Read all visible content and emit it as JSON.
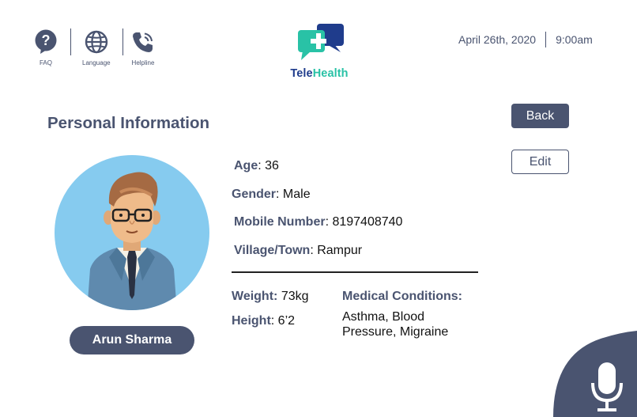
{
  "header": {
    "icons": [
      {
        "name": "faq-icon",
        "label": "FAQ"
      },
      {
        "name": "globe-icon",
        "label": "Language"
      },
      {
        "name": "phone-icon",
        "label": "Helpline"
      }
    ],
    "logo": {
      "part1": "Tele",
      "part2": "Health"
    },
    "date": "April 26th, 2020",
    "time": "9:00am"
  },
  "page": {
    "title": "Personal Information"
  },
  "actions": {
    "back_label": "Back",
    "edit_label": "Edit"
  },
  "profile": {
    "name": "Arun Sharma",
    "age_label": "Age",
    "age": "36",
    "gender_label": "Gender",
    "gender": "Male",
    "mobile_label": "Mobile Number",
    "mobile": "8197408740",
    "village_label": "Village/Town",
    "village": "Rampur",
    "weight_label": "Weight:",
    "weight": "73kg",
    "height_label": "Height",
    "height": "6’2",
    "conditions_label": "Medical Conditions:",
    "conditions": "Asthma, Blood Pressure, Migraine"
  },
  "colors": {
    "primary": "#4a5470",
    "logo_blue": "#1f3c8c",
    "logo_teal": "#29c2a6",
    "avatar_bg": "#86cbef"
  }
}
